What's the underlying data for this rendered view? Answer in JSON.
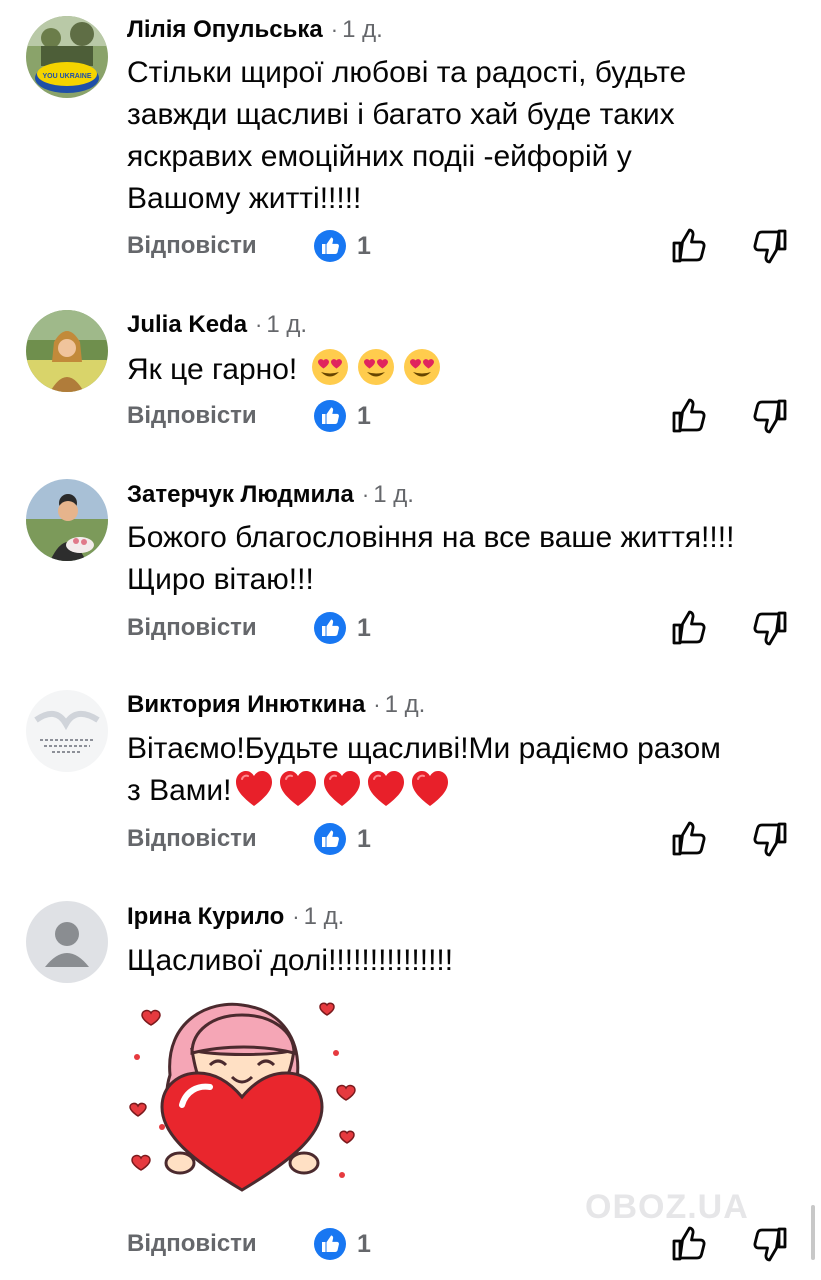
{
  "ui": {
    "reply_label": "Відповісти",
    "like_badge_icon": "like-reaction-icon",
    "like_icon": "thumbs-up-icon",
    "dislike_icon": "thumbs-down-icon",
    "accent_color": "#1877f2",
    "muted_color": "#65676b"
  },
  "comments": [
    {
      "author": "Лілія Опульська",
      "time": "1 д.",
      "avatar_text": "YOU UKRAINE",
      "lines": [
        "Стільки щирої любові та радості, будьте",
        "завжди щасливі і багато хай буде таких",
        "яскравих емоційних подіі -ейфорій у",
        "Вашому житті!!!!!"
      ],
      "likes": "1"
    },
    {
      "author": "Julia Keda",
      "time": "1 д.",
      "lines": [
        "Як це гарно!"
      ],
      "emoji": "heart-eyes-emoji",
      "likes": "1"
    },
    {
      "author": "Затерчук Людмила",
      "time": "1 д.",
      "lines": [
        "Божого благословіння на все ваше життя!!!!",
        "Щиро вітаю!!!"
      ],
      "likes": "1"
    },
    {
      "author": "Виктория Инюткина",
      "time": "1 д.",
      "lines": [
        "Вітаємо!Будьте  щасливі!Ми радіємо разом",
        "з Вами!"
      ],
      "emoji": "red-heart-emoji",
      "likes": "1"
    },
    {
      "author": "Ірина Курило",
      "time": "1 д.",
      "lines": [
        "Щасливої долі!!!!!!!!!!!!!!!"
      ],
      "sticker": "girl-hugging-heart-sticker",
      "likes": "1"
    }
  ],
  "watermark": "OBOZ.UA"
}
